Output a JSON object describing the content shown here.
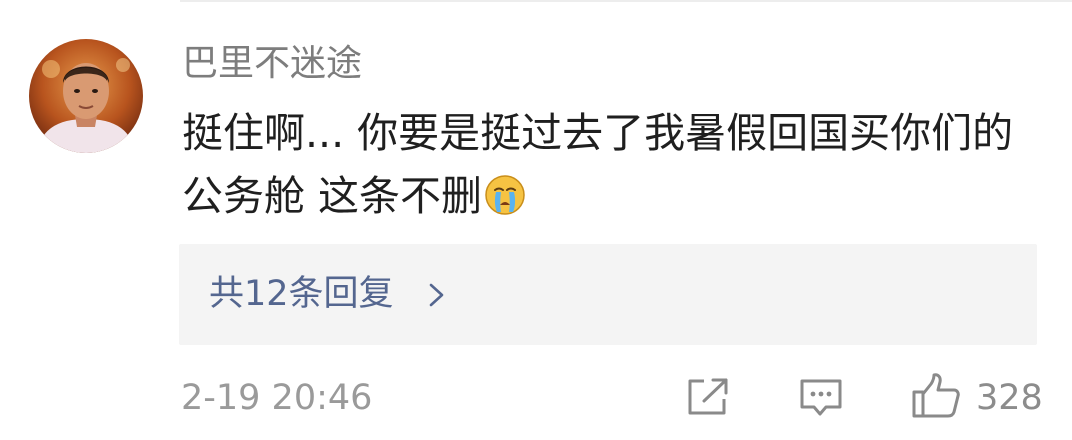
{
  "comment": {
    "username": "巴里不迷途",
    "text": "挺住啊... 你要是挺过去了我暑假回国买你们的公务舱 这条不删",
    "emoji_icon": "crying-face-icon",
    "avatar_icon": "user-avatar"
  },
  "replies": {
    "label": "共12条回复",
    "chevron_icon": "chevron-right-icon"
  },
  "footer": {
    "timestamp": "2-19 20:46",
    "share_icon": "share-icon",
    "comment_icon": "comment-icon",
    "like_icon": "thumbs-up-icon",
    "like_count": "328"
  },
  "colors": {
    "username": "#7d7d7d",
    "comment_text": "#1f1f1f",
    "reply_link": "#54668f",
    "reply_box_bg": "#f4f4f4",
    "meta": "#9a9a9a",
    "icon": "#8a8a8a"
  }
}
